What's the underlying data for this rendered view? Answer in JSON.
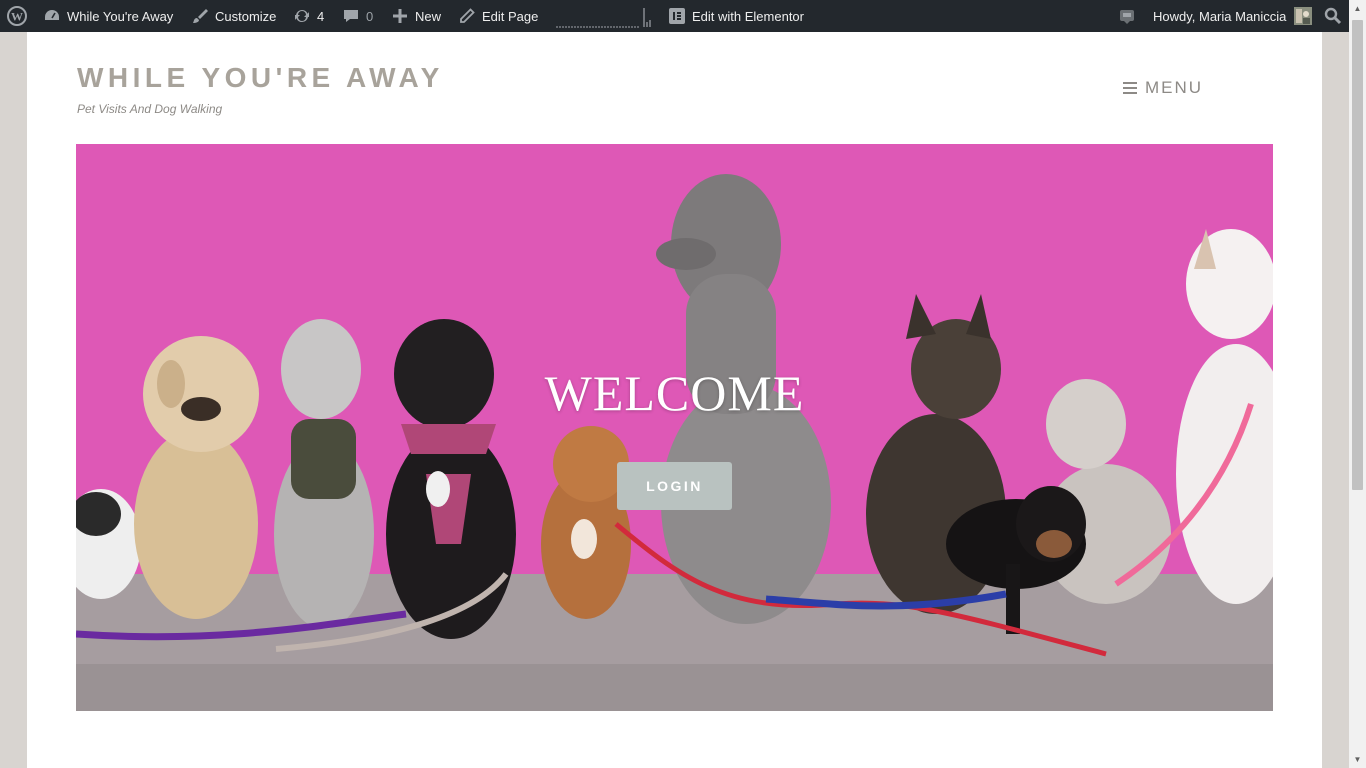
{
  "adminbar": {
    "site_name": "While You're Away",
    "customize": "Customize",
    "updates_count": "4",
    "comments_count": "0",
    "new_label": "New",
    "edit_page": "Edit Page",
    "elementor": "Edit with Elementor",
    "howdy": "Howdy, Maria Maniccia"
  },
  "site": {
    "title": "WHILE YOU'RE AWAY",
    "tagline": "Pet Visits And Dog Walking",
    "menu_label": "MENU"
  },
  "hero": {
    "title": "WELCOME",
    "button": "LOGIN"
  },
  "colors": {
    "adminbar_bg": "#23282d",
    "title_color": "#a8a39b",
    "hero_wall": "#d94fb0",
    "login_bg": "#b9c2c0"
  }
}
